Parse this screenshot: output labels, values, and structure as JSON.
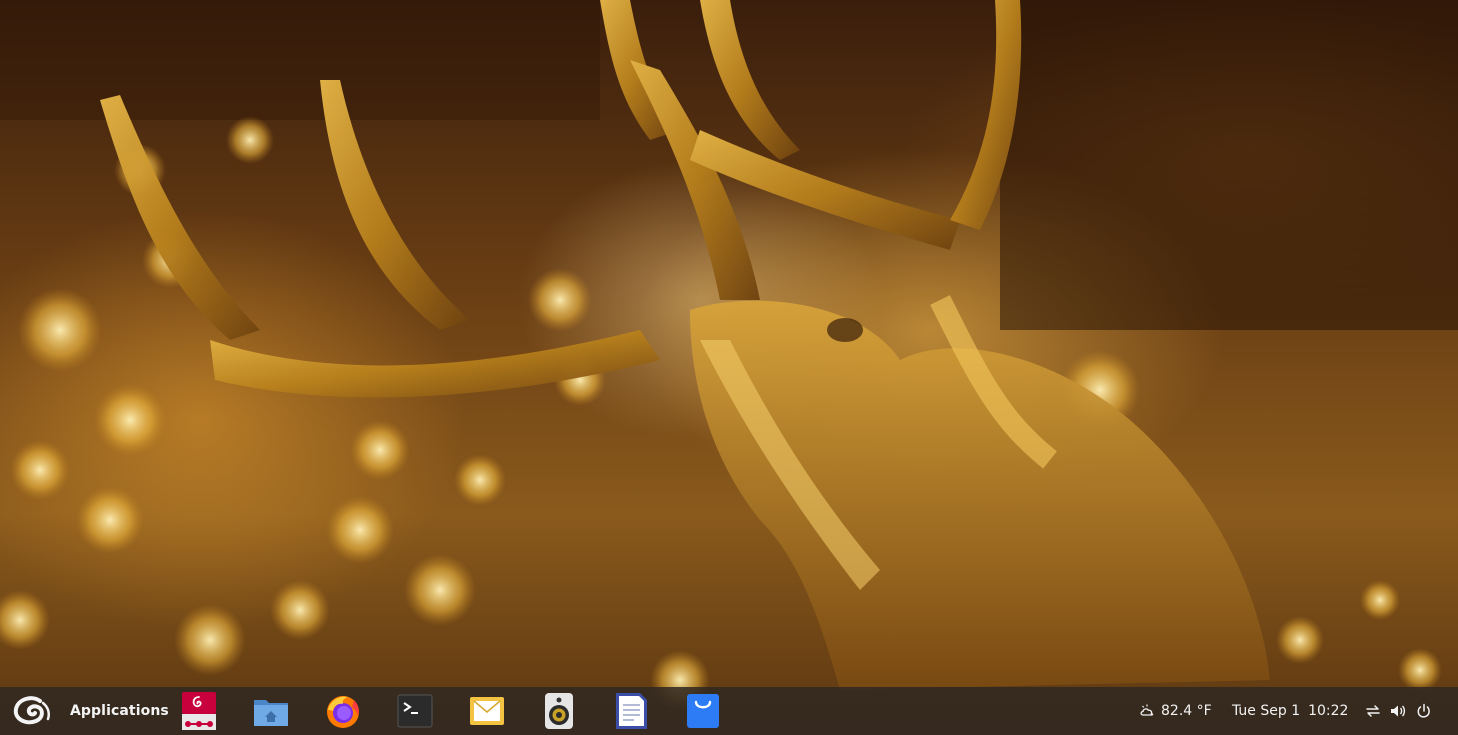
{
  "panel": {
    "applications_label": "Applications",
    "launchers": [
      {
        "name": "debian-installer",
        "icon": "debian-installer-icon"
      },
      {
        "name": "files",
        "icon": "home-folder-icon"
      },
      {
        "name": "firefox",
        "icon": "firefox-icon"
      },
      {
        "name": "terminal",
        "icon": "terminal-icon"
      },
      {
        "name": "mail",
        "icon": "mail-icon"
      },
      {
        "name": "music-player",
        "icon": "speaker-icon"
      },
      {
        "name": "text-editor",
        "icon": "document-icon"
      },
      {
        "name": "software-store",
        "icon": "shopping-bag-icon"
      }
    ],
    "weather": {
      "icon": "cloud-icon",
      "temperature": "82.4 °F"
    },
    "clock": {
      "date": "Tue Sep 1",
      "time": "10:22"
    },
    "tray": [
      {
        "name": "network",
        "icon": "network-arrows-icon"
      },
      {
        "name": "volume",
        "icon": "volume-icon"
      },
      {
        "name": "power",
        "icon": "power-icon"
      }
    ]
  },
  "colors": {
    "panel_bg": "#302822",
    "panel_text": "#f2f2f2",
    "debian_red": "#c8003c",
    "folder_blue": "#5b9bd5",
    "firefox_orange": "#ff7a00",
    "mail_yellow": "#f5c342",
    "store_blue": "#2d7cf6"
  }
}
